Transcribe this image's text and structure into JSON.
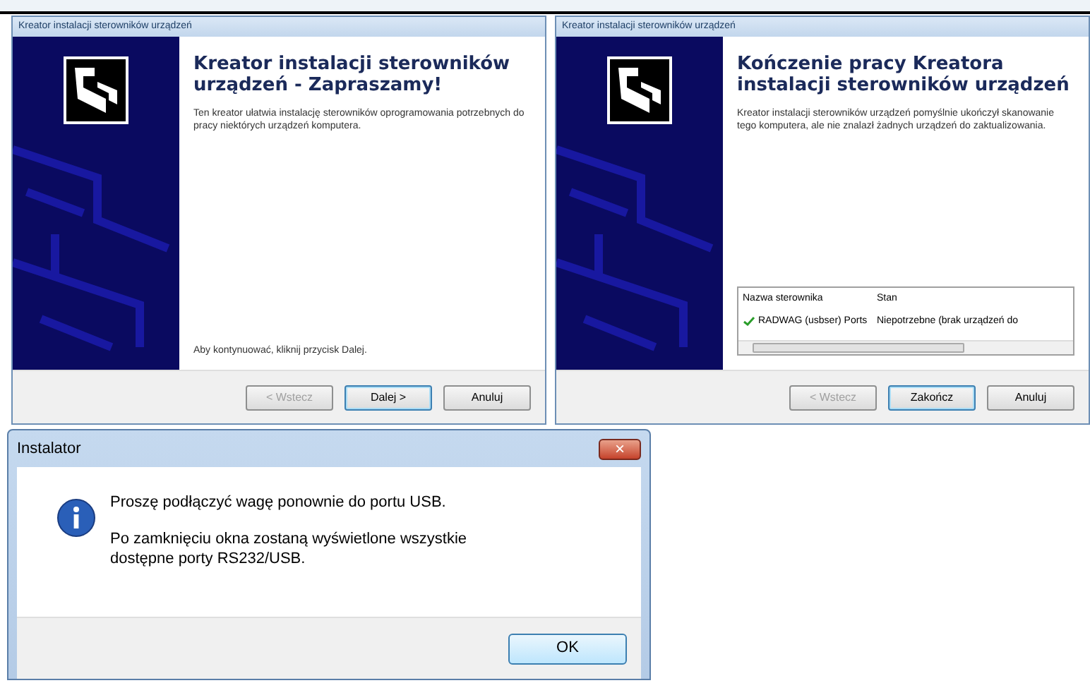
{
  "wizards": [
    {
      "title": "Kreator instalacji sterowników urządzeń",
      "heading": "Kreator instalacji sterowników urządzeń - Zapraszamy!",
      "description": "Ten kreator ułatwia instalację sterowników oprogramowania potrzebnych do pracy niektórych urządzeń komputera.",
      "footer_text": "Aby kontynuować, kliknij przycisk Dalej.",
      "buttons": [
        {
          "label": "< Wstecz",
          "disabled": true,
          "default": false
        },
        {
          "label": "Dalej >",
          "disabled": false,
          "default": true
        },
        {
          "label": "Anuluj",
          "disabled": false,
          "default": false
        }
      ]
    },
    {
      "title": "Kreator instalacji sterowników urządzeń",
      "heading": "Kończenie pracy Kreatora instalacji sterowników urządzeń",
      "description": "Kreator instalacji sterowników urządzeń pomyślnie ukończył skanowanie tego komputera, ale nie znalazł żadnych urządzeń do zaktualizowania.",
      "table": {
        "columns": [
          "Nazwa sterownika",
          "Stan"
        ],
        "rows": [
          {
            "cells": [
              "RADWAG (usbser) Ports",
              "Niepotrzebne (brak urządzeń do"
            ],
            "checked": true
          }
        ]
      },
      "buttons": [
        {
          "label": "< Wstecz",
          "disabled": true,
          "default": false
        },
        {
          "label": "Zakończ",
          "disabled": false,
          "default": true
        },
        {
          "label": "Anuluj",
          "disabled": false,
          "default": false
        }
      ]
    }
  ],
  "dialog": {
    "title": "Instalator",
    "close": "×",
    "messages": [
      "Proszę podłączyć wagę ponownie do portu USB.",
      "Po zamknięciu okna zostaną wyświetlone wszystkie dostępne porty RS232/USB."
    ],
    "button": "OK"
  }
}
